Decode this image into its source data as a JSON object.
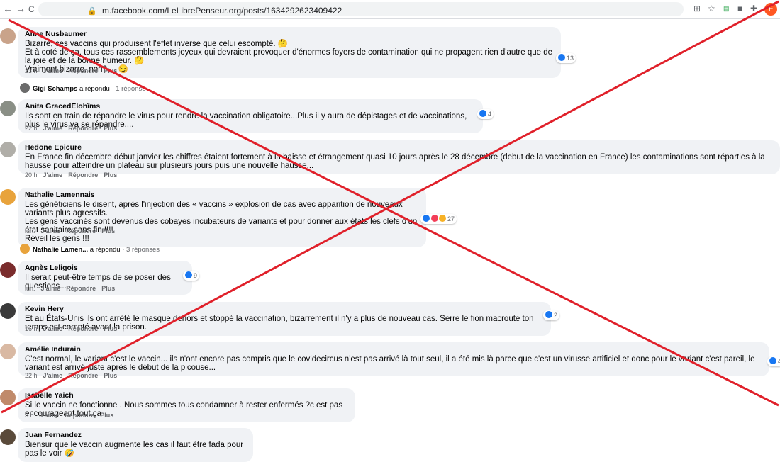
{
  "browser": {
    "url": "m.facebook.com/LeLibrePenseur.org/posts/1634292623409422",
    "back_glyph": "←",
    "forward_glyph": "→",
    "reload_glyph": "C"
  },
  "actions": {
    "like": "J'aime",
    "reply": "Répondre",
    "more": "Plus"
  },
  "comments": [
    {
      "author": "Anne Nusbaumer",
      "text": "Bizarre, ces vaccins qui produisent l'effet inverse que celui escompté. 🤔\nEt à coté de ça, tous ces rassemblements joyeux qui devraient provoquer d'énormes foyers de contamination qui ne propagent rien d'autre que de la joie et de la bonne humeur. 🤔\nVraiment bizarre, non?.... 😏",
      "time": "23 h",
      "reactions": "13"
    },
    {
      "author": "Anita GracedElohîms",
      "text": "Ils sont en train de répandre le virus pour rendre la vaccination obligatoire...Plus il y aura de dépistages et de vaccinations, plus le virus va se répandre....",
      "time": "22 h",
      "reactions": "4"
    },
    {
      "author": "Hedone Epicure",
      "text": "En France fin décembre début janvier les chiffres étaient fortement à la baisse et étrangement quasi 10 jours après le 28 décembre (debut de la vaccination en France) les contaminations sont réparties à la hausse pour atteindre un plateau sur plusieurs jours puis une nouvelle hausse...",
      "time": "20 h",
      "reactions": ""
    },
    {
      "author": "Nathalie Lamennais",
      "text": "Les généticiens le disent, après l'injection des « vaccins » explosion de cas avec apparition de nouveaux variants plus agressifs.\nLes gens vaccinés sont devenus des cobayes incubateurs de variants et pour donner aux états les clefs d'un état sanitaire sans fin !!!!\nRéveil les gens !!!",
      "time": "lun.",
      "reactions": "27"
    },
    {
      "author": "Agnès Leligois",
      "text": "Il serait peut-être temps de se poser des questions....",
      "time": "lun.",
      "reactions": "9"
    },
    {
      "author": "Kevin Hery",
      "text": "Et au États-Unis ils ont arrêté le masque dehors et stoppé la vaccination, bizarrement il n'y a plus de nouveau cas. Serre le fion macroute ton temps est compté avant la prison.",
      "time": "16 h",
      "reactions": "2"
    },
    {
      "author": "Amélie Indurain",
      "text": "C'est normal, le variant c'est le vaccin... ils n'ont encore pas compris que le covidecircus n'est pas arrivé là tout seul, il a été mis là parce que c'est un virusse artificiel et donc pour le variant c'est pareil, le variant est arrivé juste après le début de la picouse...",
      "time": "22 h",
      "reactions": "4"
    },
    {
      "author": "Isabelle Yaich",
      "text": "Si le vaccin ne fonctionne . Nous sommes tous condamner à rester enfermés ?c est pas encourageant tout ça",
      "time": "3 h",
      "reactions": ""
    },
    {
      "author": "Juan Fernandez",
      "text": "Biensur que le vaccin augmente les cas il faut être fada pour pas le voir 🤣",
      "time": "",
      "reactions": ""
    }
  ],
  "replies": [
    {
      "name": "Gigi Schamps",
      "suffix": " a répondu",
      "count": " · 1 réponse"
    },
    {
      "name": "Nathalie Lamen...",
      "suffix": " a répondu",
      "count": " · 3 réponses"
    }
  ],
  "colors": {
    "cross": "#e0202a",
    "bubble": "#f0f2f5",
    "like": "#1877f2"
  }
}
